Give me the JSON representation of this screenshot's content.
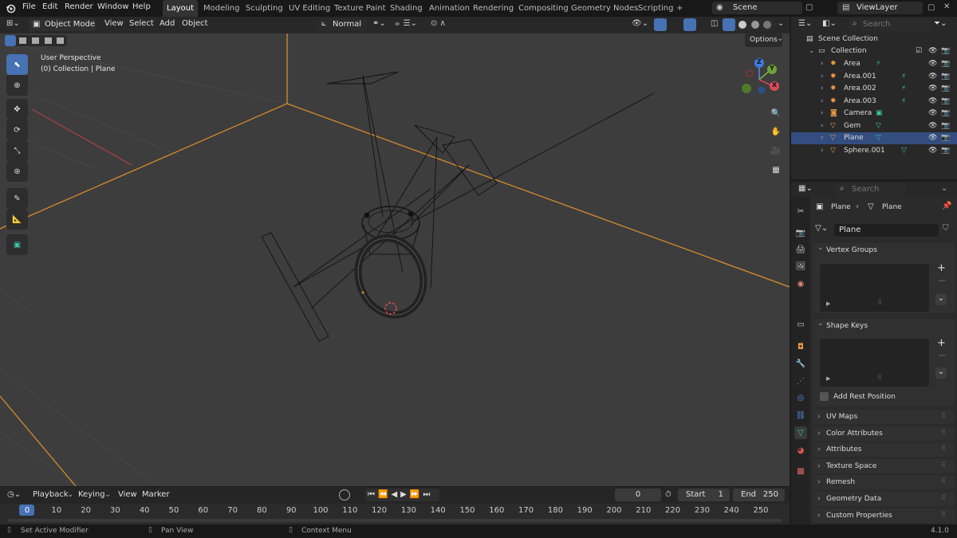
{
  "topbar": {
    "menus": [
      "File",
      "Edit",
      "Render",
      "Window",
      "Help"
    ],
    "workspaces": [
      "Layout",
      "Modeling",
      "Sculpting",
      "UV Editing",
      "Texture Paint",
      "Shading",
      "Animation",
      "Rendering",
      "Compositing",
      "Geometry Nodes",
      "Scripting"
    ],
    "add_tab": "+",
    "scene": "Scene",
    "view_layer": "ViewLayer"
  },
  "viewport": {
    "mode": "Object Mode",
    "menus": [
      "View",
      "Select",
      "Add",
      "Object"
    ],
    "orientation": "Normal",
    "options": "Options",
    "overlay_line1": "User Perspective",
    "overlay_line2": "(0) Collection | Plane",
    "gizmo": {
      "x": "X",
      "y": "Y",
      "z": "Z"
    }
  },
  "timeline": {
    "menus": [
      "Playback",
      "Keying",
      "View",
      "Marker"
    ],
    "current_frame": "0",
    "start_label": "Start",
    "start": "1",
    "end_label": "End",
    "end": "250",
    "ticks": [
      "0",
      "10",
      "20",
      "30",
      "40",
      "50",
      "60",
      "70",
      "80",
      "90",
      "100",
      "110",
      "120",
      "130",
      "140",
      "150",
      "160",
      "170",
      "180",
      "190",
      "200",
      "210",
      "220",
      "230",
      "240",
      "250"
    ]
  },
  "status": {
    "left": "Set Active Modifier",
    "middle": "Pan View",
    "right": "Context Menu",
    "version": "4.1.0"
  },
  "outliner": {
    "search_placeholder": "Search",
    "root": "Scene Collection",
    "collection": "Collection",
    "items": [
      {
        "name": "Area",
        "type": "light"
      },
      {
        "name": "Area.001",
        "type": "light"
      },
      {
        "name": "Area.002",
        "type": "light"
      },
      {
        "name": "Area.003",
        "type": "light"
      },
      {
        "name": "Camera",
        "type": "camera"
      },
      {
        "name": "Gem",
        "type": "mesh"
      },
      {
        "name": "Plane",
        "type": "mesh",
        "selected": true
      },
      {
        "name": "Sphere.001",
        "type": "mesh"
      }
    ]
  },
  "properties": {
    "search_placeholder": "Search",
    "breadcrumb_object": "Plane",
    "breadcrumb_data": "Plane",
    "data_name": "Plane",
    "panels": {
      "vertex_groups": "Vertex Groups",
      "shape_keys": "Shape Keys",
      "add_rest_position": "Add Rest Position",
      "collapsed": [
        "UV Maps",
        "Color Attributes",
        "Attributes",
        "Texture Space",
        "Remesh",
        "Geometry Data",
        "Custom Properties"
      ]
    }
  },
  "colors": {
    "accent": "#4772b3",
    "selection": "#334d80",
    "mesh_icon": "#3cc2a4",
    "light_icon": "#e89744",
    "grid_axis_orange": "#d68a2c",
    "axis_red": "#b04040"
  }
}
